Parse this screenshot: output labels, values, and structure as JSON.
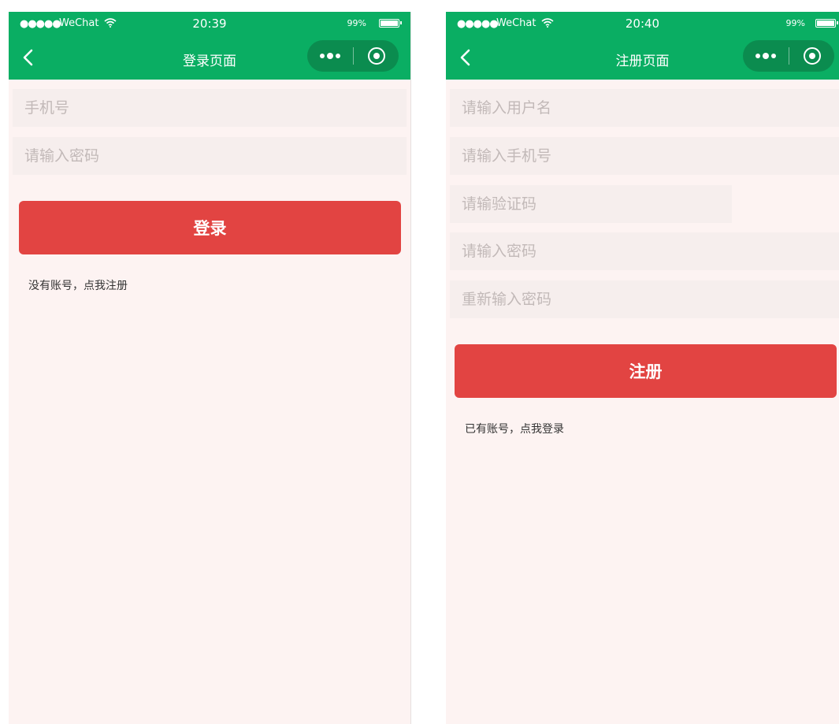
{
  "status_bar": {
    "signal": "●●●●●",
    "carrier": "WeChat",
    "battery_percent": "99%"
  },
  "colors": {
    "header_green": "#0aae63",
    "capsule_green": "#0b8c4f",
    "page_background": "#fdf3f2",
    "field_background": "#f6eeed",
    "button_red": "#e24442",
    "placeholder_gray": "#c2b9b8"
  },
  "icons": {
    "back": "chevron-left-icon",
    "wifi": "wifi-icon",
    "battery": "battery-icon",
    "more": "more-dots-icon",
    "close": "target-close-icon"
  },
  "login": {
    "time": "20:39",
    "title": "登录页面",
    "fields": {
      "phone_placeholder": "手机号",
      "password_placeholder": "请输入密码"
    },
    "button_label": "登录",
    "switch_link": "没有账号，点我注册"
  },
  "register": {
    "time": "20:40",
    "title": "注册页面",
    "fields": {
      "username_placeholder": "请输入用户名",
      "phone_placeholder": "请输入手机号",
      "code_placeholder": "请输验证码",
      "password_placeholder": "请输入密码",
      "confirm_placeholder": "重新输入密码"
    },
    "button_label": "注册",
    "switch_link": "已有账号，点我登录"
  }
}
